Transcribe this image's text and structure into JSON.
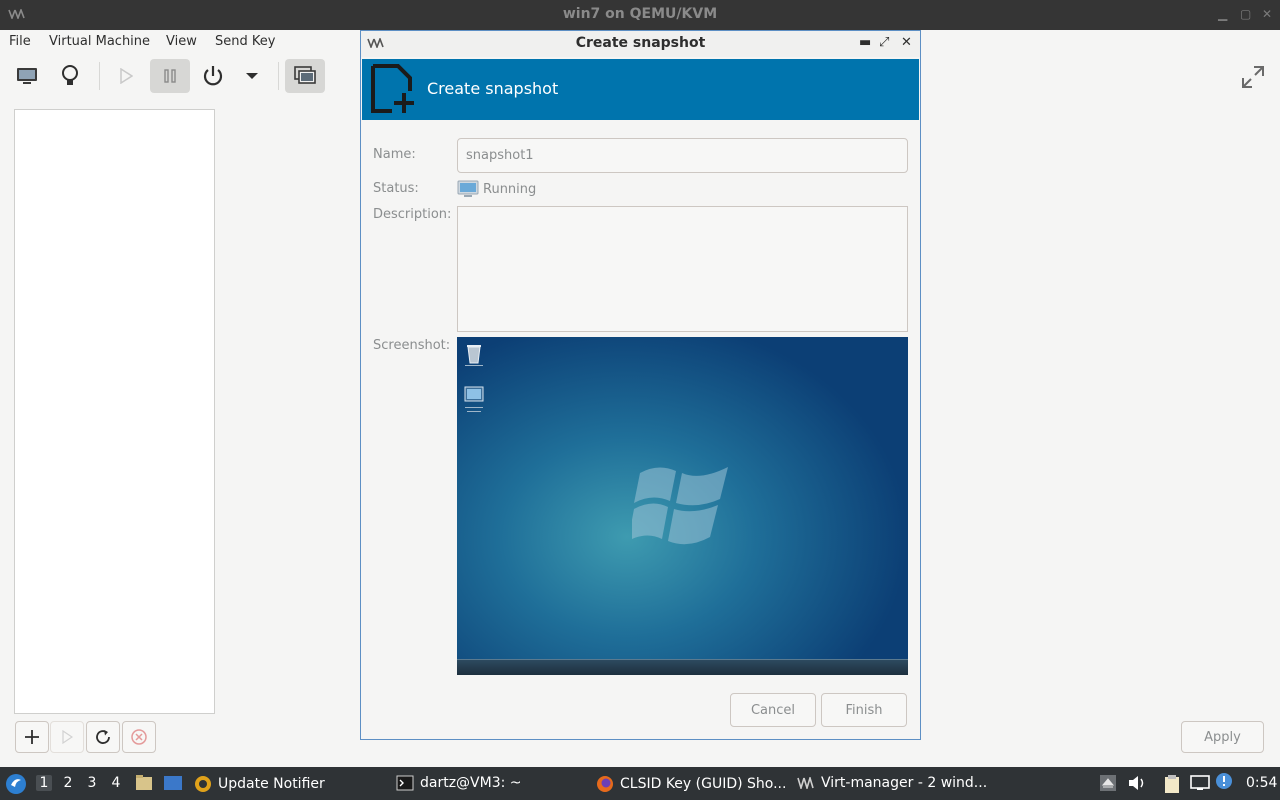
{
  "main_window": {
    "title": "win7 on QEMU/KVM",
    "menu": [
      "File",
      "Virtual Machine",
      "View",
      "Send Key"
    ],
    "apply_label": "Apply"
  },
  "dialog": {
    "window_title": "Create snapshot",
    "header_title": "Create snapshot",
    "name_label": "Name:",
    "name_value": "snapshot1",
    "status_label": "Status:",
    "status_value": "Running",
    "description_label": "Description:",
    "description_value": "",
    "screenshot_label": "Screenshot:",
    "cancel_label": "Cancel",
    "finish_label": "Finish"
  },
  "taskbar": {
    "workspaces": [
      "1",
      "2",
      "3",
      "4"
    ],
    "active_workspace": "1",
    "apps": [
      {
        "label": "Update Notifier",
        "icon": "update-notifier-icon"
      },
      {
        "label": "dartz@VM3: ~",
        "icon": "terminal-icon"
      },
      {
        "label": "CLSID Key (GUID) Sho...",
        "icon": "firefox-icon"
      },
      {
        "label": "Virt-manager - 2 wind...",
        "icon": "virt-manager-icon"
      }
    ],
    "clock": "0:54"
  },
  "colors": {
    "dialog_header": "#0074ad",
    "panel": "#2f3336",
    "titlebar": "#353535"
  }
}
